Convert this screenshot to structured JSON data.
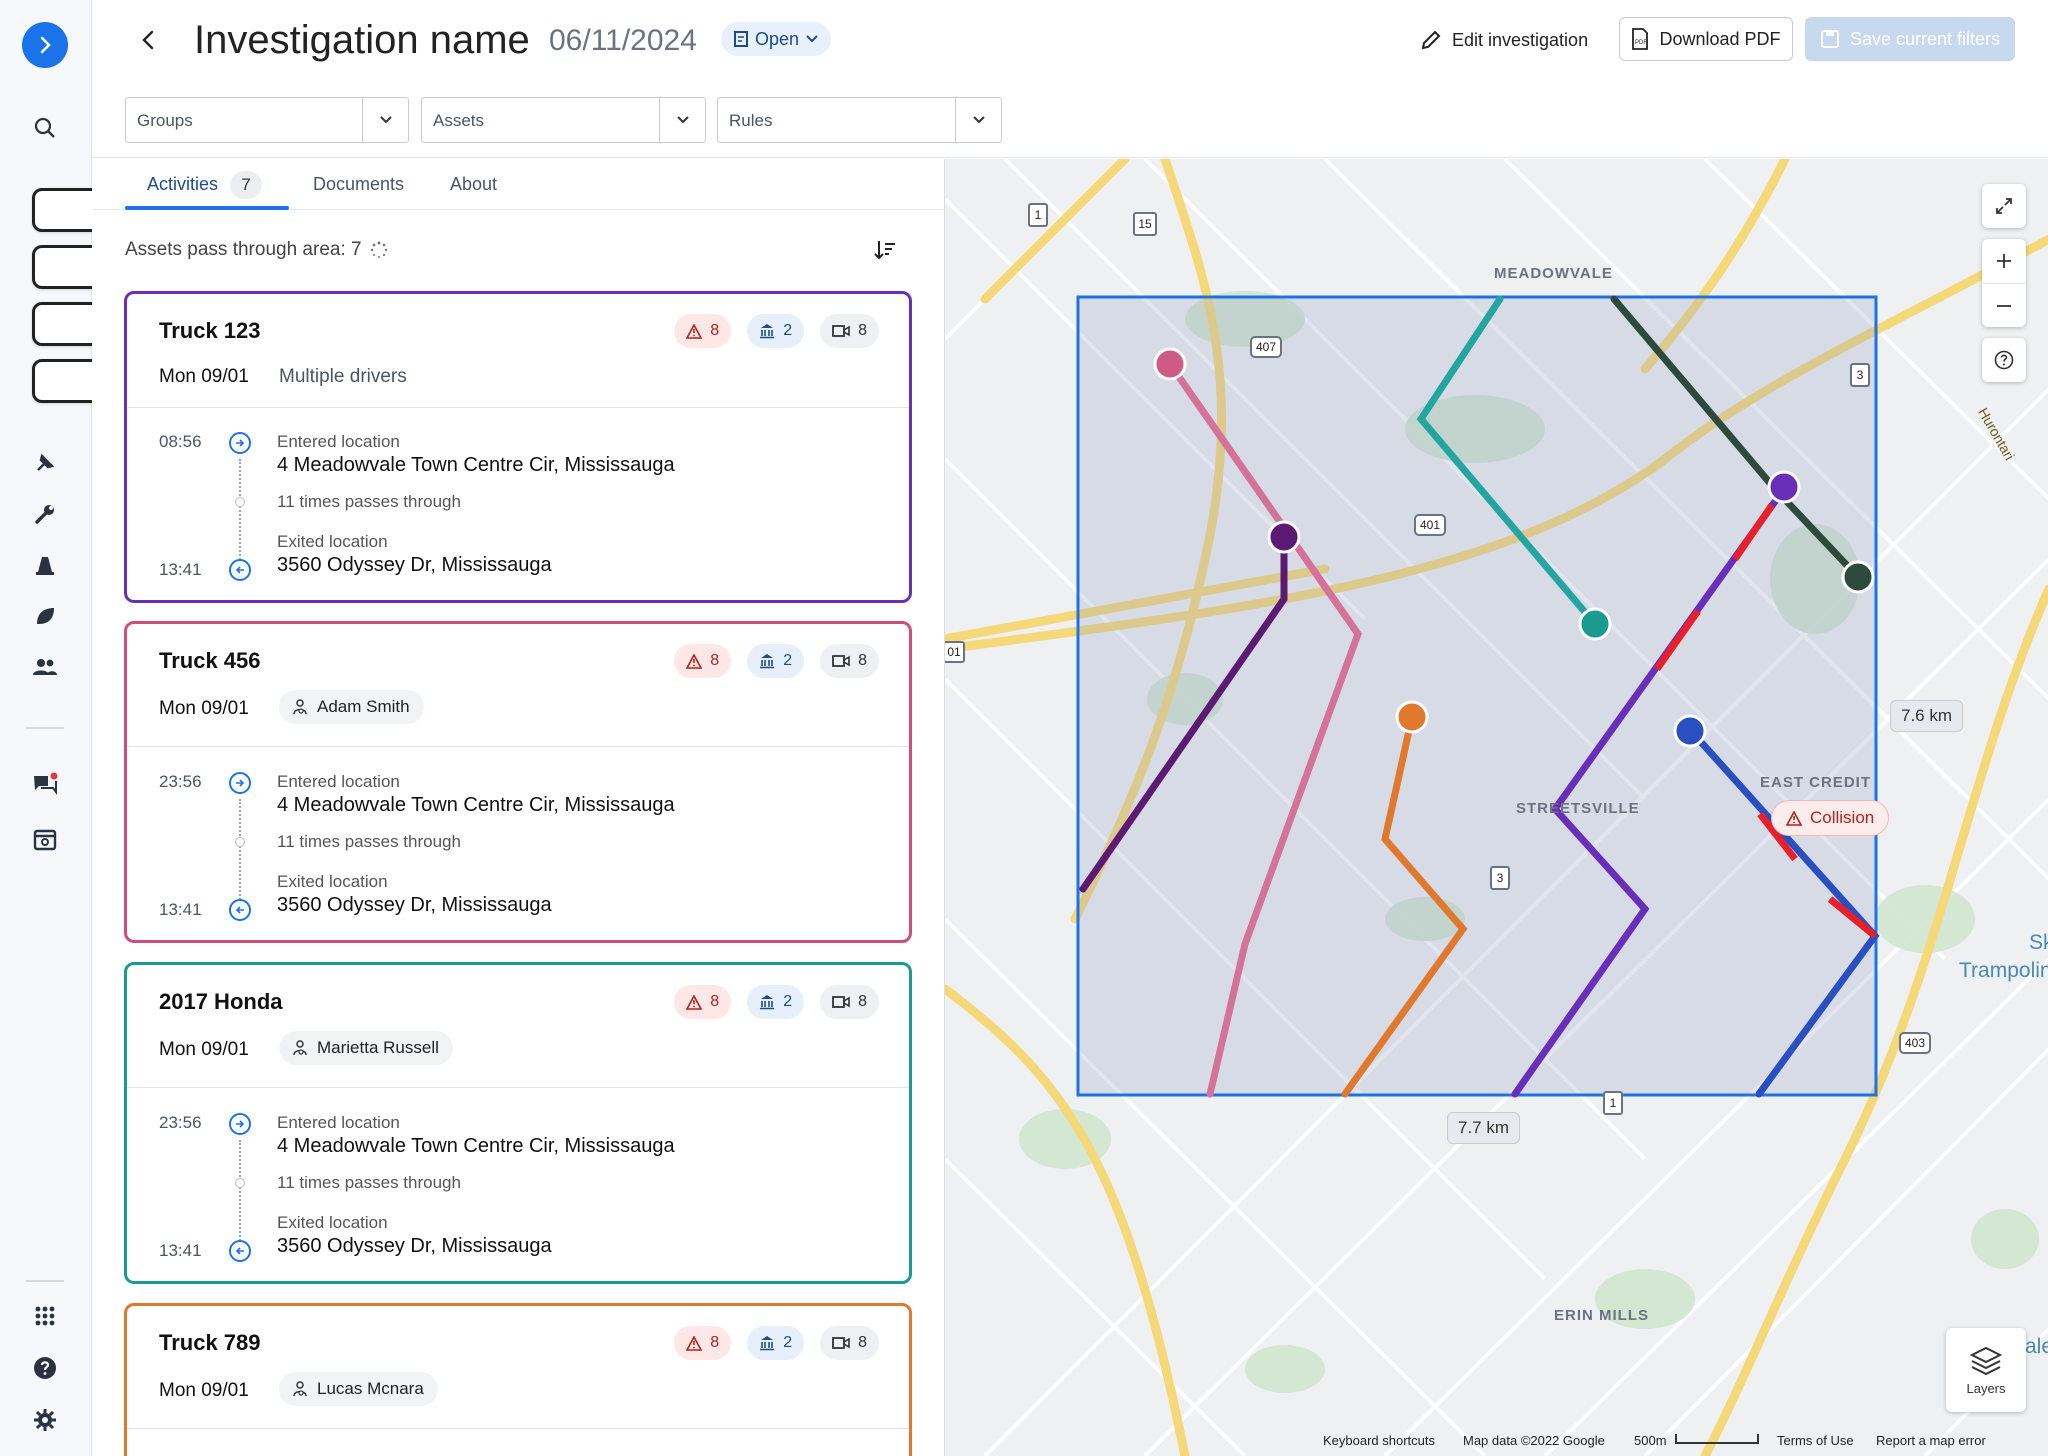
{
  "header": {
    "title": "Investigation name",
    "date": "06/11/2024",
    "status": "Open",
    "edit_label": "Edit investigation",
    "pdf_label": "Download PDF",
    "save_label": "Save current filters"
  },
  "filters": {
    "groups": "Groups",
    "assets": "Assets",
    "rules": "Rules"
  },
  "tabs": [
    {
      "label": "Activities",
      "count": "7"
    },
    {
      "label": "Documents"
    },
    {
      "label": "About"
    }
  ],
  "summary": "Assets pass through area: 7",
  "cards": [
    {
      "name": "Truck 123",
      "color": "#6a2fb8",
      "warn": "8",
      "docs": "2",
      "video": "8",
      "day": "Mon 09/01",
      "driver": "Multiple drivers",
      "entered_time": "08:56",
      "entered_label": "Entered location",
      "entered_addr": "4 Meadowvale Town Centre Cir, Mississauga",
      "passes": "11 times passes through",
      "exited_time": "13:41",
      "exited_label": "Exited location",
      "exited_addr": "3560 Odyssey Dr, Mississauga"
    },
    {
      "name": "Truck 456",
      "color": "#d04c7a",
      "warn": "8",
      "docs": "2",
      "video": "8",
      "day": "Mon 09/01",
      "driver": "Adam Smith",
      "entered_time": "23:56",
      "entered_label": "Entered location",
      "entered_addr": "4 Meadowvale Town Centre Cir, Mississauga",
      "passes": "11 times passes through",
      "exited_time": "13:41",
      "exited_label": "Exited location",
      "exited_addr": "3560 Odyssey Dr, Mississauga"
    },
    {
      "name": "2017 Honda",
      "color": "#1a9a91",
      "warn": "8",
      "docs": "2",
      "video": "8",
      "day": "Mon 09/01",
      "driver": "Marietta Russell",
      "entered_time": "23:56",
      "entered_label": "Entered location",
      "entered_addr": "4 Meadowvale Town Centre Cir, Mississauga",
      "passes": "11 times passes through",
      "exited_time": "13:41",
      "exited_label": "Exited location",
      "exited_addr": "3560 Odyssey Dr, Mississauga"
    },
    {
      "name": "Truck 789",
      "color": "#e0782e",
      "warn": "8",
      "docs": "2",
      "video": "8",
      "day": "Mon 09/01",
      "driver": "Lucas Mcnara"
    }
  ],
  "map": {
    "places": {
      "meadowvale": "MEADOWVALE",
      "streetsville": "STREETSVILLE",
      "east_credit": "EAST CREDIT",
      "erin_mills": "ERIN MILLS",
      "trampoline": "Trampolin",
      "sk": "Sk",
      "hurontario": "Hurontari",
      "ale": "ale"
    },
    "width_label": "7.7 km",
    "height_label": "7.6 km",
    "collision_label": "Collision",
    "layers_label": "Layers",
    "shields": [
      "1",
      "15",
      "407",
      "401",
      "3",
      "403",
      "01",
      "1"
    ],
    "attribution": {
      "shortcuts": "Keyboard shortcuts",
      "data": "Map data ©2022 Google",
      "scale": "500m",
      "terms": "Terms of Use",
      "report": "Report a map error"
    }
  },
  "icons": {
    "rail": [
      "chevron-right-icon",
      "search-icon",
      "home-icon",
      "truck-icon",
      "map-pin-icon",
      "bookmark-icon",
      "pin-icon",
      "wrench-icon",
      "cone-icon",
      "leaf-icon",
      "people-icon",
      "chat-icon",
      "calendar-icon",
      "apps-icon",
      "help-icon",
      "settings-icon"
    ]
  },
  "colors": {
    "accent": "#1a73e8",
    "area_border": "#1a73e8",
    "route_truck123": "#6a2fb8",
    "route_truck456": "#d4729a",
    "route_honda": "#23a6a0",
    "route_truck789": "#e0782e",
    "route_blue": "#2a4fc0",
    "route_dark": "#2e4a3d",
    "route_violet": "#5c1a73",
    "event_red": "#e8202a"
  }
}
